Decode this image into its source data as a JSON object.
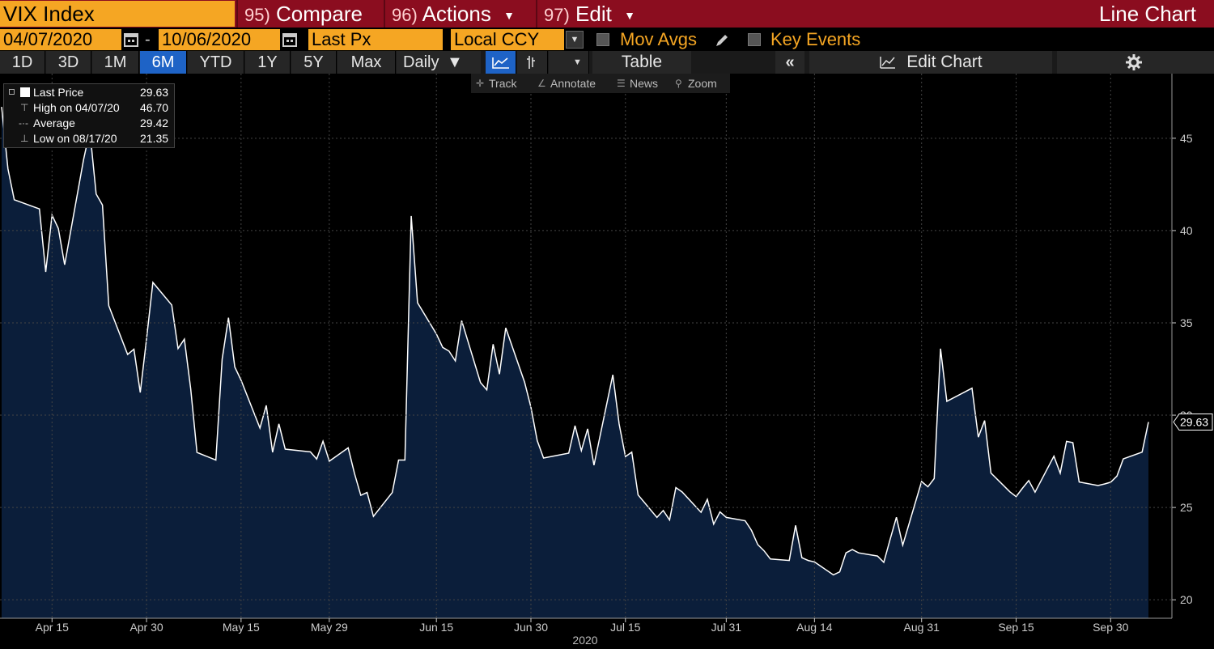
{
  "header": {
    "ticker": "VIX Index",
    "menus": [
      {
        "num": "95)",
        "label": "Compare"
      },
      {
        "num": "96)",
        "label": "Actions"
      },
      {
        "num": "97)",
        "label": "Edit"
      }
    ],
    "chart_type": "Line Chart",
    "title_bar_color": "#8b0d1f",
    "field_color": "#f5a623"
  },
  "controls": {
    "start_date": "04/07/2020",
    "end_date": "10/06/2020",
    "date_separator": "-",
    "field": "Last Px",
    "currency": "Local CCY",
    "mov_avgs": "Mov Avgs",
    "key_events": "Key Events"
  },
  "toolbar": {
    "ranges": [
      "1D",
      "3D",
      "1M",
      "6M",
      "YTD",
      "1Y",
      "5Y",
      "Max"
    ],
    "active_range": "6M",
    "frequency": "Daily",
    "table": "Table",
    "collapse": "«",
    "edit_chart": "Edit Chart"
  },
  "subtools": {
    "track": "Track",
    "annotate": "Annotate",
    "news": "News",
    "zoom": "Zoom"
  },
  "legend": {
    "last_label": "Last Price",
    "last_value": "29.63",
    "high_label": "High on 04/07/20",
    "high_value": "46.70",
    "avg_label": "Average",
    "avg_value": "29.42",
    "low_label": "Low on 08/17/20",
    "low_value": "21.35"
  },
  "chart_data": {
    "type": "area",
    "year_label": "2020",
    "x_tick_labels": [
      "Apr 15",
      "Apr 30",
      "May 15",
      "May 29",
      "Jun 15",
      "Jun 30",
      "Jul 15",
      "Jul 31",
      "Aug 14",
      "Aug 31",
      "Sep 15",
      "Sep 30"
    ],
    "y_ticks": [
      20,
      25,
      30,
      35,
      40,
      45
    ],
    "y_tick_labels": [
      "20",
      "25",
      "30",
      "35",
      "40",
      "45"
    ],
    "ylim": [
      19.0,
      48.5
    ],
    "last_value_label": "29.63",
    "line_color": "#ffffff",
    "fill_color": "#0b1e3a",
    "x": [
      "2020-04-07",
      "2020-04-08",
      "2020-04-09",
      "2020-04-13",
      "2020-04-14",
      "2020-04-15",
      "2020-04-16",
      "2020-04-17",
      "2020-04-20",
      "2020-04-21",
      "2020-04-22",
      "2020-04-23",
      "2020-04-24",
      "2020-04-27",
      "2020-04-28",
      "2020-04-29",
      "2020-04-30",
      "2020-05-01",
      "2020-05-04",
      "2020-05-05",
      "2020-05-06",
      "2020-05-07",
      "2020-05-08",
      "2020-05-11",
      "2020-05-12",
      "2020-05-13",
      "2020-05-14",
      "2020-05-15",
      "2020-05-18",
      "2020-05-19",
      "2020-05-20",
      "2020-05-21",
      "2020-05-22",
      "2020-05-26",
      "2020-05-27",
      "2020-05-28",
      "2020-05-29",
      "2020-06-01",
      "2020-06-02",
      "2020-06-03",
      "2020-06-04",
      "2020-06-05",
      "2020-06-08",
      "2020-06-09",
      "2020-06-10",
      "2020-06-11",
      "2020-06-12",
      "2020-06-15",
      "2020-06-16",
      "2020-06-17",
      "2020-06-18",
      "2020-06-19",
      "2020-06-22",
      "2020-06-23",
      "2020-06-24",
      "2020-06-25",
      "2020-06-26",
      "2020-06-29",
      "2020-06-30",
      "2020-07-01",
      "2020-07-02",
      "2020-07-06",
      "2020-07-07",
      "2020-07-08",
      "2020-07-09",
      "2020-07-10",
      "2020-07-13",
      "2020-07-14",
      "2020-07-15",
      "2020-07-16",
      "2020-07-17",
      "2020-07-20",
      "2020-07-21",
      "2020-07-22",
      "2020-07-23",
      "2020-07-24",
      "2020-07-27",
      "2020-07-28",
      "2020-07-29",
      "2020-07-30",
      "2020-07-31",
      "2020-08-03",
      "2020-08-04",
      "2020-08-05",
      "2020-08-06",
      "2020-08-07",
      "2020-08-10",
      "2020-08-11",
      "2020-08-12",
      "2020-08-13",
      "2020-08-14",
      "2020-08-17",
      "2020-08-18",
      "2020-08-19",
      "2020-08-20",
      "2020-08-21",
      "2020-08-24",
      "2020-08-25",
      "2020-08-26",
      "2020-08-27",
      "2020-08-28",
      "2020-08-31",
      "2020-09-01",
      "2020-09-02",
      "2020-09-03",
      "2020-09-04",
      "2020-09-08",
      "2020-09-09",
      "2020-09-10",
      "2020-09-11",
      "2020-09-14",
      "2020-09-15",
      "2020-09-16",
      "2020-09-17",
      "2020-09-18",
      "2020-09-21",
      "2020-09-22",
      "2020-09-23",
      "2020-09-24",
      "2020-09-25",
      "2020-09-28",
      "2020-09-29",
      "2020-09-30",
      "2020-10-01",
      "2020-10-02",
      "2020-10-05",
      "2020-10-06"
    ],
    "y": [
      46.7,
      43.35,
      41.67,
      41.17,
      37.76,
      40.84,
      40.11,
      38.15,
      43.83,
      45.41,
      41.98,
      41.38,
      35.93,
      33.29,
      33.57,
      31.23,
      34.15,
      37.19,
      35.97,
      33.61,
      34.12,
      31.44,
      27.98,
      27.57,
      33.04,
      35.28,
      32.61,
      31.89,
      29.3,
      30.53,
      27.99,
      29.53,
      28.16,
      28.01,
      27.62,
      28.59,
      27.51,
      28.23,
      26.84,
      25.66,
      25.81,
      24.52,
      25.81,
      27.57,
      27.57,
      40.79,
      36.09,
      34.4,
      33.67,
      33.47,
      32.94,
      35.12,
      31.77,
      31.37,
      33.84,
      32.22,
      34.73,
      31.78,
      30.43,
      28.62,
      27.68,
      27.94,
      29.43,
      28.08,
      29.26,
      27.29,
      32.19,
      29.52,
      27.76,
      28.0,
      25.68,
      24.46,
      24.84,
      24.32,
      26.08,
      25.84,
      24.74,
      25.44,
      24.1,
      24.76,
      24.46,
      24.28,
      23.76,
      22.99,
      22.65,
      22.21,
      22.13,
      24.03,
      22.28,
      22.13,
      22.05,
      21.35,
      21.51,
      22.54,
      22.72,
      22.54,
      22.37,
      22.03,
      23.27,
      24.47,
      22.96,
      26.41,
      26.12,
      26.57,
      33.6,
      30.75,
      31.46,
      28.81,
      29.71,
      26.87,
      25.85,
      25.59,
      26.04,
      26.46,
      25.83,
      27.78,
      26.86,
      28.58,
      28.51,
      26.38,
      26.19,
      26.27,
      26.37,
      26.7,
      27.63,
      28.0,
      29.63
    ]
  }
}
